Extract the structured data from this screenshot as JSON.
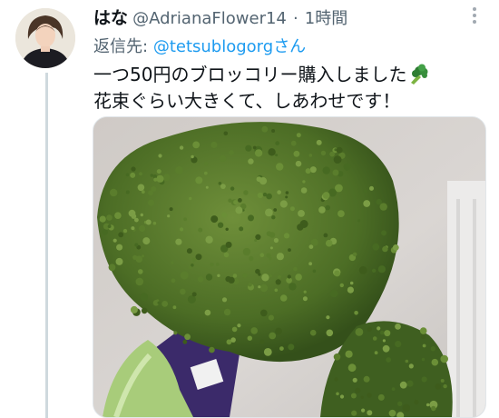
{
  "tweet": {
    "display_name": "はな",
    "handle": "@AdrianaFlower14",
    "separator": "·",
    "time": "1時間",
    "reply_label": "返信先:",
    "reply_handle": "@tetsublogorg",
    "reply_suffix": "さん",
    "text_line1": "一つ50円のブロッコリー購入しました",
    "text_line2": "花束ぐらい大きくて、しあわせです！",
    "emoji_icon": "broccoli-emoji",
    "media_label": "broccoli photo"
  },
  "colors": {
    "link": "#1d9bf0",
    "secondary_text": "#536471",
    "thread_line": "#cfd9de"
  }
}
